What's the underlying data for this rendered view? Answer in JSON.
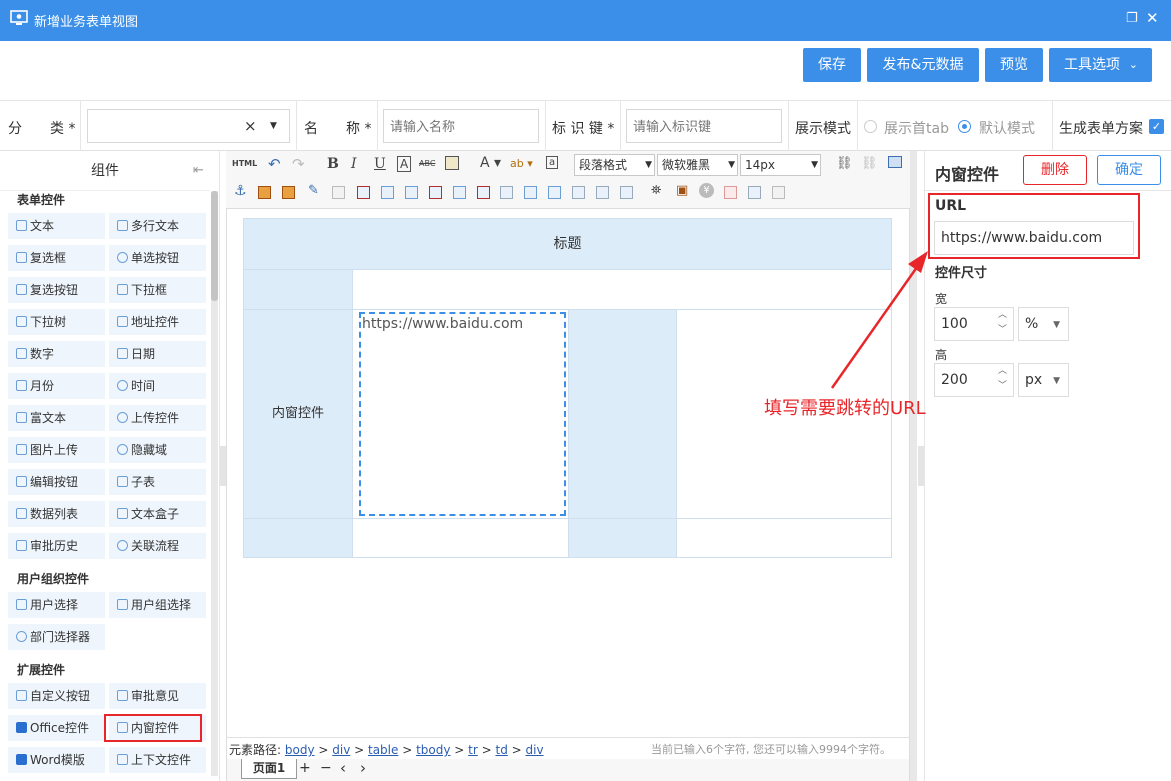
{
  "window": {
    "title": "新增业务表单视图"
  },
  "actions": {
    "save": "保存",
    "publish": "发布&元数据",
    "preview": "预览",
    "tools": "工具选项"
  },
  "form": {
    "category_label": "分　　类 *",
    "category_clear": "×",
    "name_label": "名　　称 *",
    "name_placeholder": "请输入名称",
    "key_label": "标 识 键 *",
    "key_placeholder": "请输入标识键",
    "mode_label": "展示模式",
    "mode_option1": "展示首tab",
    "mode_option2": "默认模式",
    "gen_label": "生成表单方案"
  },
  "left": {
    "header": "组件",
    "sections": [
      {
        "title": "表单控件",
        "items": [
          "文本",
          "多行文本",
          "复选框",
          "单选按钮",
          "复选按钮",
          "下拉框",
          "下拉树",
          "地址控件",
          "数字",
          "日期",
          "月份",
          "时间",
          "富文本",
          "上传控件",
          "图片上传",
          "隐藏域",
          "编辑按钮",
          "子表",
          "数据列表",
          "文本盒子",
          "审批历史",
          "关联流程"
        ]
      },
      {
        "title": "用户组织控件",
        "items": [
          "用户选择",
          "用户组选择",
          "部门选择器"
        ]
      },
      {
        "title": "扩展控件",
        "items": [
          "自定义按钮",
          "审批意见",
          "Office控件",
          "内窗控件",
          "Word模版",
          "上下文控件"
        ]
      }
    ]
  },
  "toolbar": {
    "html": "HTML",
    "paragraph": "段落格式",
    "font": "微软雅黑",
    "size": "14px"
  },
  "canvas": {
    "title": "标题",
    "row_label": "内窗控件",
    "iframe_url": "https://www.baidu.com"
  },
  "status": {
    "path_label": "元素路径:",
    "path": [
      "body",
      "div",
      "table",
      "tbody",
      "tr",
      "td",
      "div"
    ],
    "count_text": "当前已输入6个字符, 您还可以输入9994个字符。"
  },
  "pages": {
    "tab": "页面1",
    "add": "+",
    "remove": "−",
    "prev": "‹",
    "next": "›"
  },
  "right": {
    "title": "内窗控件",
    "delete": "删除",
    "confirm": "确定",
    "url_label": "URL",
    "url_value": "https://www.baidu.com",
    "size_label": "控件尺寸",
    "width_label": "宽",
    "width_value": "100",
    "width_unit": "%",
    "height_label": "高",
    "height_value": "200",
    "height_unit": "px"
  },
  "annotation": "填写需要跳转的URL",
  "colors": {
    "primary": "#3b8fe8",
    "danger": "#e8262a",
    "cell": "#ddecf9"
  }
}
